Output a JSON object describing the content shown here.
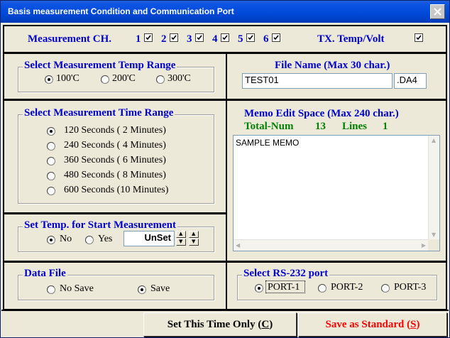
{
  "window": {
    "title": "Basis measurement Condition and Communication Port"
  },
  "channels": {
    "label": "Measurement CH.",
    "items": [
      {
        "num": "1",
        "checked": true
      },
      {
        "num": "2",
        "checked": true
      },
      {
        "num": "3",
        "checked": true
      },
      {
        "num": "4",
        "checked": true
      },
      {
        "num": "5",
        "checked": true
      },
      {
        "num": "6",
        "checked": true
      }
    ],
    "tx_label": "TX. Temp/Volt",
    "tx_checked": true
  },
  "temp_range": {
    "title": "Select Measurement Temp Range",
    "options": [
      "100'C",
      "200'C",
      "300'C"
    ],
    "selected": 0
  },
  "file_name": {
    "title": "File Name (Max 30 char.)",
    "value": "TEST01",
    "extension": ".DA4"
  },
  "time_range": {
    "title": "Select Measurement Time Range",
    "options": [
      "120 Seconds ( 2 Minutes)",
      "240 Seconds ( 4 Minutes)",
      "360 Seconds ( 6 Minutes)",
      "480 Seconds ( 8 Minutes)",
      "600 Seconds (10 Minutes)"
    ],
    "selected": 0
  },
  "memo": {
    "title": "Memo Edit Space (Max 240 char.)",
    "total_label": "Total-Num",
    "total_value": "13",
    "lines_label": "Lines",
    "lines_value": "1",
    "content": "SAMPLE MEMO"
  },
  "start_temp": {
    "title": "Set Temp. for Start Measurement",
    "options": [
      "No",
      "Yes"
    ],
    "selected": 0,
    "value": "UnSet"
  },
  "data_file": {
    "title": "Data File",
    "options": [
      "No Save",
      "Save"
    ],
    "selected": 1
  },
  "rs232": {
    "title": "Select RS-232 port",
    "options": [
      "PORT-1",
      "PORT-2",
      "PORT-3"
    ],
    "selected": 0
  },
  "buttons": {
    "this_time_prefix": "Set This Time Only (",
    "this_time_key": "C",
    "this_time_suffix": ")",
    "standard_prefix": "Save as Standard (",
    "standard_key": "S",
    "standard_suffix": ")"
  },
  "colors": {
    "label_blue": "#0000cc",
    "count_green": "#008000",
    "warn_red": "#ff0000",
    "titlebar": "#0048d8"
  }
}
